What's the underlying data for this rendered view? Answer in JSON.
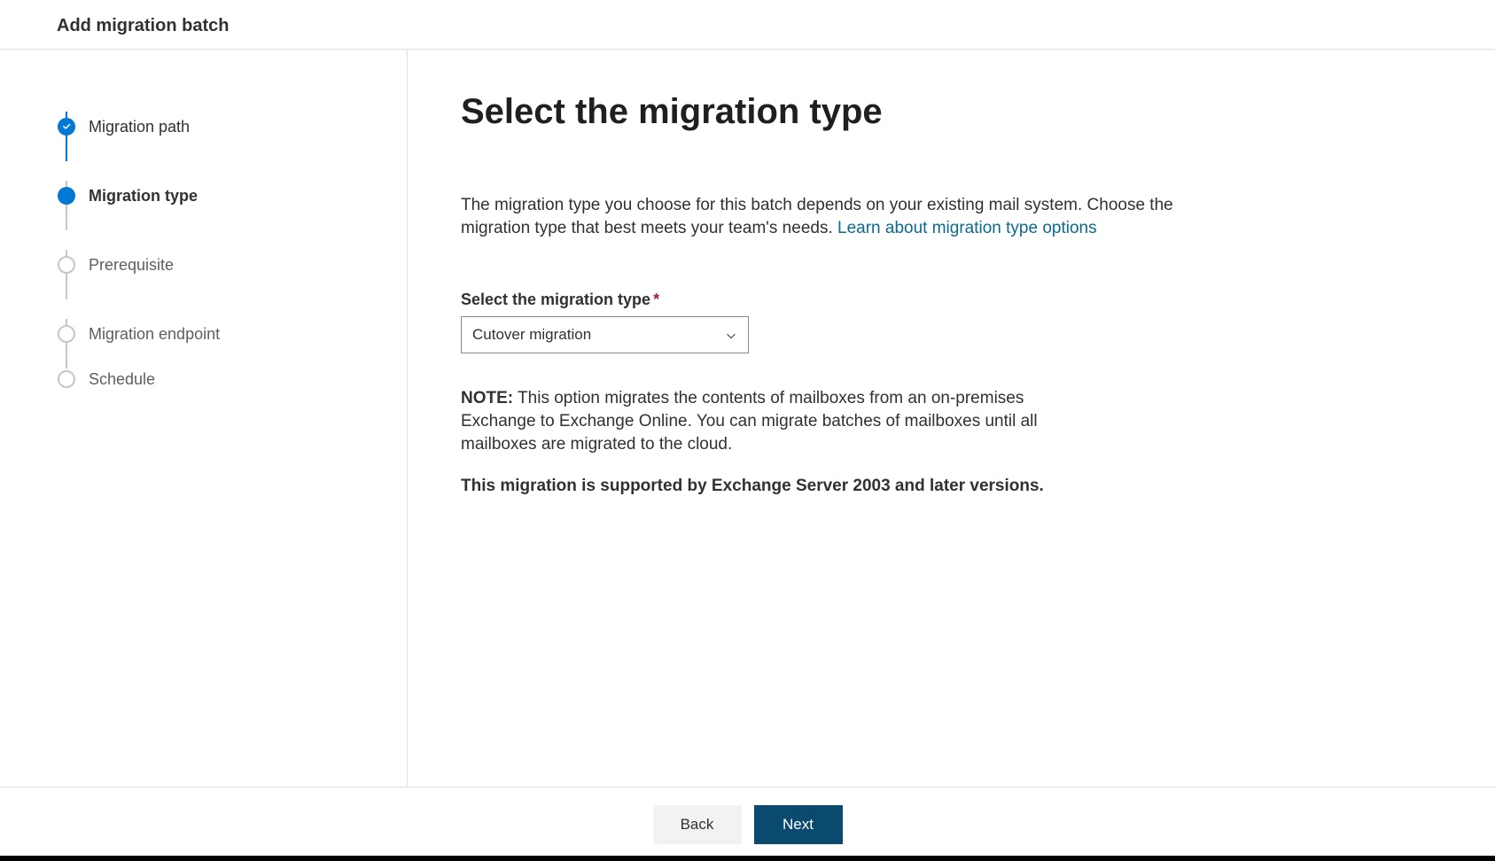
{
  "header": {
    "title": "Add migration batch"
  },
  "steps": [
    {
      "label": "Migration path",
      "state": "completed"
    },
    {
      "label": "Migration type",
      "state": "current"
    },
    {
      "label": "Prerequisite",
      "state": "upcoming"
    },
    {
      "label": "Migration endpoint",
      "state": "upcoming"
    },
    {
      "label": "Schedule",
      "state": "upcoming"
    }
  ],
  "content": {
    "title": "Select the migration type",
    "description_text": "The migration type you choose for this batch depends on your existing mail system. Choose the migration type that best meets your team's needs. ",
    "description_link": "Learn about migration type options",
    "field_label": "Select the migration type",
    "required_marker": "*",
    "select_value": "Cutover migration",
    "note_label": "NOTE:",
    "note_text": " This option migrates the contents of mailboxes from an on-premises Exchange to Exchange Online. You can migrate batches of mailboxes until all mailboxes are migrated to the cloud.",
    "note_support": "This migration is supported by Exchange Server 2003 and later versions."
  },
  "footer": {
    "back_label": "Back",
    "next_label": "Next"
  }
}
